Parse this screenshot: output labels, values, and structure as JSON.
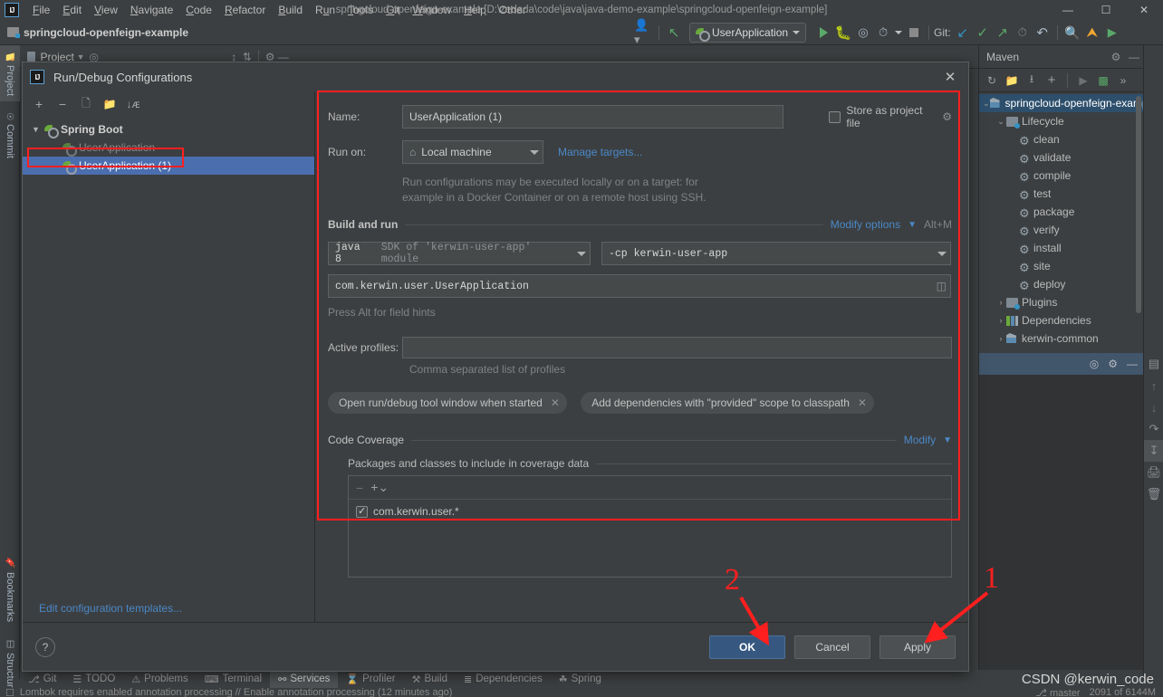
{
  "window": {
    "title": "springcloud-openfeign-example [D:\\zedada\\code\\java\\java-demo-example\\springcloud-openfeign-example]",
    "minimize": "—",
    "maximize": "☐",
    "close": "✕"
  },
  "menu": {
    "items": [
      "File",
      "Edit",
      "View",
      "Navigate",
      "Code",
      "Refactor",
      "Build",
      "Run",
      "Tools",
      "Git",
      "Window",
      "Help",
      "Other"
    ]
  },
  "navbar": {
    "breadcrumb": "springcloud-openfeign-example",
    "run_config": "UserApplication",
    "git_label": "Git:"
  },
  "left_strip": {
    "tabs": [
      {
        "label": "Project",
        "selected": true
      },
      {
        "label": "Commit",
        "selected": false
      },
      {
        "label": "Bookmarks",
        "selected": false
      },
      {
        "label": "Structure",
        "selected": false
      }
    ]
  },
  "project_header": {
    "title": "Project"
  },
  "dialog": {
    "title": "Run/Debug Configurations",
    "icon_text": "IJ",
    "close": "✕",
    "tree": {
      "group": "Spring Boot",
      "items": [
        {
          "label": "UserApplication",
          "selected": false
        },
        {
          "label": "UserApplication (1)",
          "selected": true
        }
      ]
    },
    "edit_templates": "Edit configuration templates...",
    "form": {
      "name_label": "Name:",
      "name_value": "UserApplication (1)",
      "store_as_project_file": "Store as project file",
      "run_on_label": "Run on:",
      "run_on_value": "Local machine",
      "manage_targets": "Manage targets...",
      "hint_line1": "Run configurations may be executed locally or on a target: for",
      "hint_line2": "example in a Docker Container or on a remote host using SSH.",
      "build_and_run": "Build and run",
      "modify_options": "Modify options",
      "modify_options_shortcut": "Alt+M",
      "jdk_bold": "java 8",
      "jdk_rest": "SDK of 'kerwin-user-app' module",
      "cp_value": "-cp kerwin-user-app",
      "main_class": "com.kerwin.user.UserApplication",
      "alt_hint": "Press Alt for field hints",
      "active_profiles_label": "Active profiles:",
      "active_profiles_value": "",
      "profiles_hint": "Comma separated list of profiles",
      "chips": [
        "Open run/debug tool window when started",
        "Add dependencies with \"provided\" scope to classpath"
      ],
      "code_coverage": "Code Coverage",
      "code_coverage_modify": "Modify",
      "packages_label": "Packages and classes to include in coverage data",
      "coverage_items": [
        {
          "label": "com.kerwin.user.*",
          "checked": true
        }
      ]
    },
    "footer": {
      "help": "?",
      "ok": "OK",
      "cancel": "Cancel",
      "apply": "Apply"
    }
  },
  "maven": {
    "title": "Maven",
    "tree": [
      {
        "label": "springcloud-openfeign-example",
        "icon": "maven-project-icon",
        "indent": 0,
        "chevron": "⌄",
        "selected": true
      },
      {
        "label": "Lifecycle",
        "icon": "folder-icon",
        "indent": 1,
        "chevron": "⌄",
        "selected": false
      },
      {
        "label": "clean",
        "icon": "gear-icon",
        "indent": 2,
        "chevron": "",
        "selected": false
      },
      {
        "label": "validate",
        "icon": "gear-icon",
        "indent": 2,
        "chevron": "",
        "selected": false
      },
      {
        "label": "compile",
        "icon": "gear-icon",
        "indent": 2,
        "chevron": "",
        "selected": false
      },
      {
        "label": "test",
        "icon": "gear-icon",
        "indent": 2,
        "chevron": "",
        "selected": false
      },
      {
        "label": "package",
        "icon": "gear-icon",
        "indent": 2,
        "chevron": "",
        "selected": false
      },
      {
        "label": "verify",
        "icon": "gear-icon",
        "indent": 2,
        "chevron": "",
        "selected": false
      },
      {
        "label": "install",
        "icon": "gear-icon",
        "indent": 2,
        "chevron": "",
        "selected": false
      },
      {
        "label": "site",
        "icon": "gear-icon",
        "indent": 2,
        "chevron": "",
        "selected": false
      },
      {
        "label": "deploy",
        "icon": "gear-icon",
        "indent": 2,
        "chevron": "",
        "selected": false
      },
      {
        "label": "Plugins",
        "icon": "folder-icon",
        "indent": 1,
        "chevron": "›",
        "selected": false
      },
      {
        "label": "Dependencies",
        "icon": "deps-icon",
        "indent": 1,
        "chevron": "›",
        "selected": false
      },
      {
        "label": "kerwin-common",
        "icon": "maven-project-icon",
        "indent": 1,
        "chevron": "›",
        "selected": false
      }
    ]
  },
  "bottom_tabs": [
    {
      "label": "Git",
      "icon": "branch-icon",
      "selected": false
    },
    {
      "label": "TODO",
      "icon": "list-icon",
      "selected": false
    },
    {
      "label": "Problems",
      "icon": "warning-icon",
      "selected": false
    },
    {
      "label": "Terminal",
      "icon": "terminal-icon",
      "selected": false
    },
    {
      "label": "Services",
      "icon": "services-icon",
      "selected": true
    },
    {
      "label": "Profiler",
      "icon": "profiler-icon",
      "selected": false
    },
    {
      "label": "Build",
      "icon": "hammer-icon",
      "selected": false
    },
    {
      "label": "Dependencies",
      "icon": "layers-icon",
      "selected": false
    },
    {
      "label": "Spring",
      "icon": "spring-icon",
      "selected": false
    }
  ],
  "statusbar": {
    "message": "Lombok requires enabled annotation processing // Enable annotation processing (12 minutes ago)",
    "branch": "master",
    "memory": "2091 of 6144M"
  },
  "annotations": {
    "mark_1": "1",
    "mark_2": "2"
  },
  "watermark": "CSDN @kerwin_code",
  "colors": {
    "accent": "#4a88c7",
    "primary_button": "#365880",
    "selection": "#4b6eaf",
    "annotation_red": "#ff1f1f",
    "background": "#3c3f41"
  }
}
